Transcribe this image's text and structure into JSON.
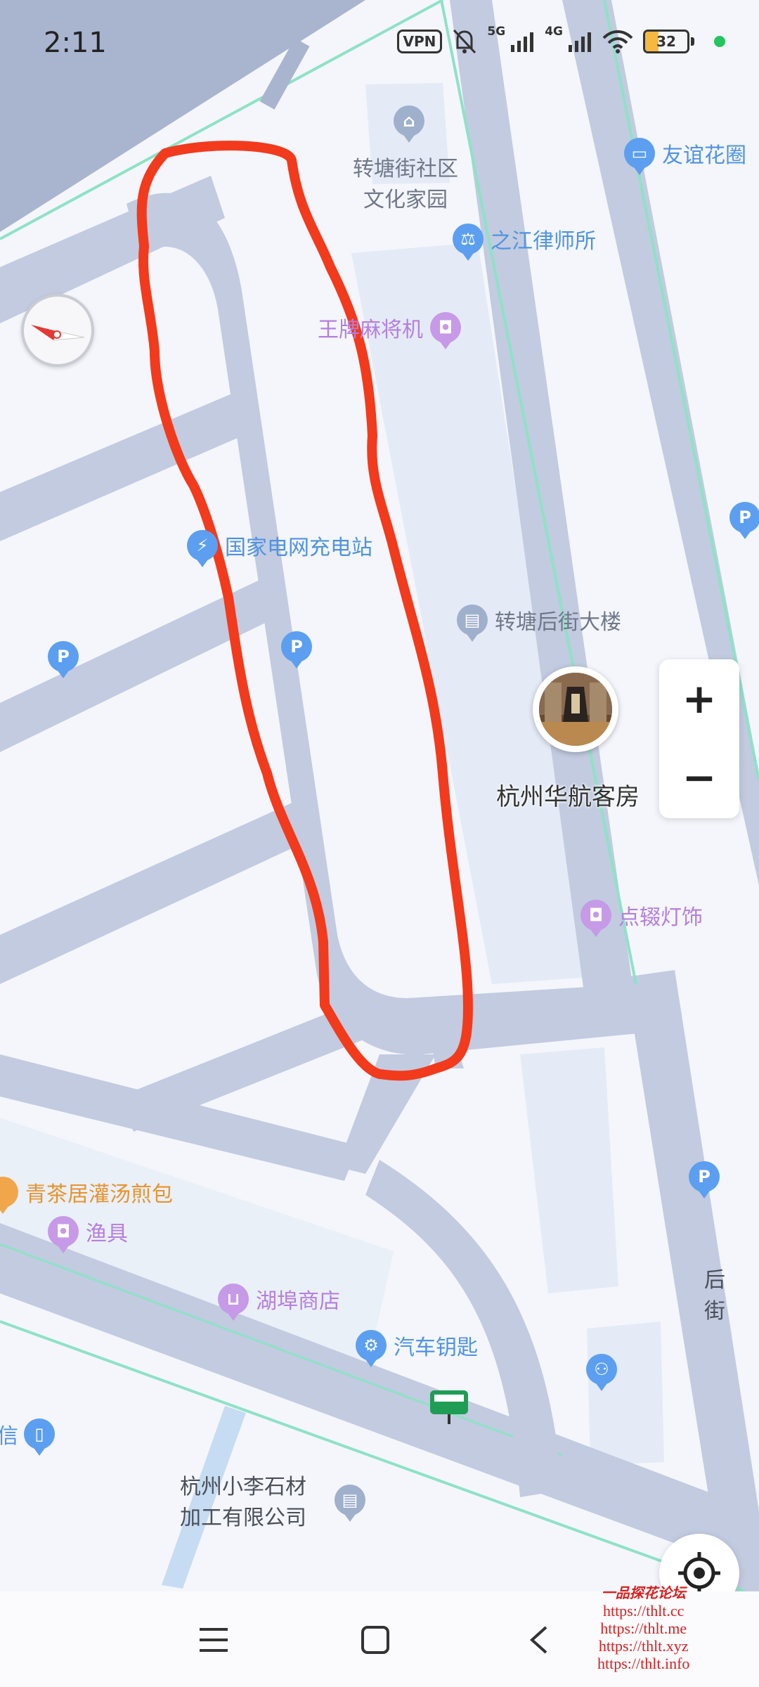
{
  "status": {
    "time": "2:11",
    "vpn": "VPN",
    "net1": "5G",
    "net2": "4G",
    "battery": "32",
    "battery_level": 0.32
  },
  "map": {
    "pois": [
      {
        "id": "poi-community-center-1",
        "text": "转塘街社区"
      },
      {
        "id": "poi-community-center-2",
        "text": "文化家园"
      },
      {
        "id": "poi-law-firm",
        "text": "之江律师所"
      },
      {
        "id": "poi-mahjong",
        "text": "王牌麻将机"
      },
      {
        "id": "poi-garden",
        "text": "友谊花圈"
      },
      {
        "id": "poi-charging",
        "text": "国家电网充电站"
      },
      {
        "id": "poi-building",
        "text": "转塘后街大楼"
      },
      {
        "id": "poi-lighting",
        "text": "点辍灯饰"
      },
      {
        "id": "poi-tea",
        "text": "青茶居灌汤煎包"
      },
      {
        "id": "poi-fishing",
        "text": "渔具"
      },
      {
        "id": "poi-shop",
        "text": "湖埠商店"
      },
      {
        "id": "poi-car-key",
        "text": "汽车钥匙"
      },
      {
        "id": "poi-xin",
        "text": "信"
      },
      {
        "id": "poi-stone-1",
        "text": "杭州小李石材"
      },
      {
        "id": "poi-stone-2",
        "text": "加工有限公司"
      },
      {
        "id": "poi-street-1",
        "text": "后"
      },
      {
        "id": "poi-street-2",
        "text": "街"
      }
    ],
    "photo_marker_label": "杭州华航客房",
    "parking_label": "P",
    "zoom_in": "+",
    "zoom_out": "−"
  },
  "watermark": {
    "title": "一品探花论坛",
    "urls": [
      "https://thlt.cc",
      "https://thlt.me",
      "https://thlt.xyz",
      "https://thlt.info"
    ]
  },
  "colors": {
    "road": "#c2cbe0",
    "road_dark": "#a8b4d0",
    "greenline": "#8ee2c6",
    "route": "#f23a1d",
    "block": "#e4ebf6"
  }
}
